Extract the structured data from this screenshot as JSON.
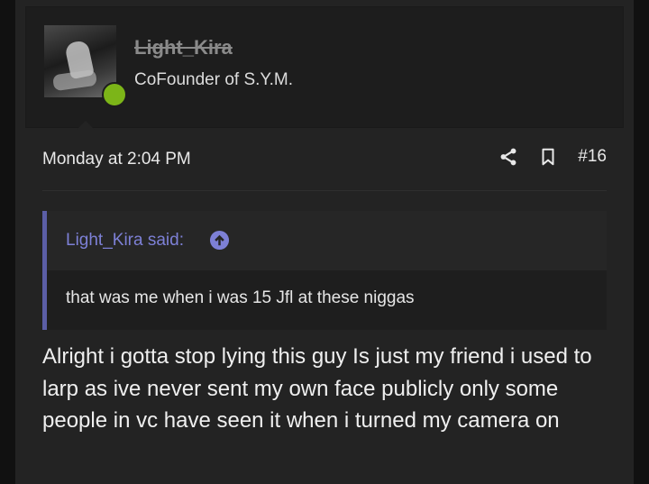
{
  "post": {
    "username": "Light_Kira",
    "user_title": "CoFounder of S.Y.M.",
    "online": true,
    "timestamp": "Monday at 2:04 PM",
    "post_number": "#16",
    "quote": {
      "author_line": "Light_Kira said:",
      "text": "that was me when i was 15 Jfl at these niggas"
    },
    "message": "Alright i gotta stop lying this guy Is just my friend i used to larp as ive never sent my own face publicly only some people in vc have seen it when i turned my camera on"
  },
  "icons": {
    "share": "share-icon",
    "bookmark": "bookmark-icon",
    "quote_jump": "arrow-up-circle-icon"
  },
  "colors": {
    "background": "#232323",
    "online_status": "#7cb518",
    "quote_accent": "#5b5ea6",
    "quote_author": "#7d80d6"
  }
}
